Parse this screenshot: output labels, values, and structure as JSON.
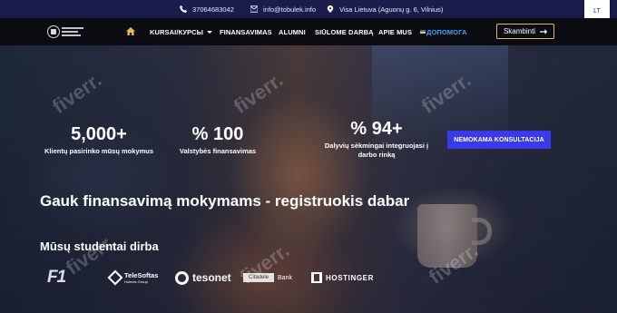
{
  "topbar": {
    "phone": "37064683042",
    "email": "info@tobulek.info",
    "address": "Visa Lietuva (Aguonų g. 6, Vilnius)",
    "lang": "LT"
  },
  "nav": {
    "items": [
      "KURSAI/КУРСЫ",
      "FINANSAVIMAS",
      "ALUMNI",
      "SIŪLOME DARBĄ",
      "APIE MUS",
      "ДОПОМОГА"
    ],
    "call_label": "Skambinti"
  },
  "hero": {
    "stats": [
      {
        "value": "5,000+",
        "label": "Klientų pasirinko mūsų mokymus"
      },
      {
        "value": "% 100",
        "label": "Valstybės finansavimas"
      },
      {
        "value": "% 94+",
        "label": "Dalyvių sėkmingai integruojasi į darbo rinką"
      }
    ],
    "cta_label": "NEMOKAMA KONSULTACIJA",
    "headline": "Gauk finansavimą mokymams - registruokis dabar",
    "subheading": "Mūsų studentai dirba",
    "partners": {
      "f1": "F1",
      "telesoftas": "TeleSoftas",
      "telesoftas_sub": "Holmes Group",
      "tesonet": "tesonet",
      "bank_box": "Citadele",
      "bank": "Bank",
      "hostinger": "HOSTINGER"
    },
    "watermark": "fiverr."
  },
  "colors": {
    "topbar": "#1a1d4c",
    "nav": "#0b0c12",
    "cta": "#3a3aea",
    "call_border": "#e6b94f",
    "help_link": "#3ea0ff"
  }
}
